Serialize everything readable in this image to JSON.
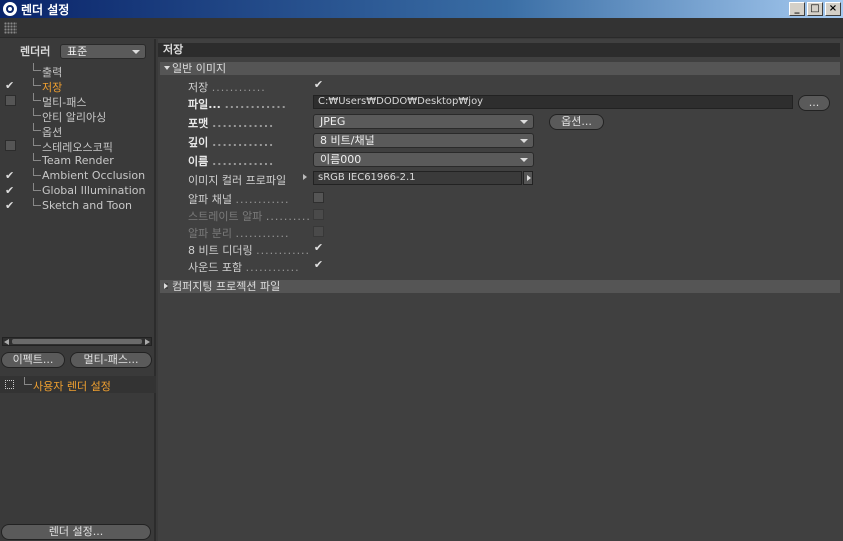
{
  "window": {
    "title": "렌더 설정",
    "minimize": "_",
    "maximize": "□",
    "close": "×"
  },
  "left": {
    "renderer_label": "렌더러",
    "renderer_value": "표준",
    "tree": [
      {
        "label": "출력",
        "check": "none"
      },
      {
        "label": "저장",
        "check": "checked",
        "selected": true
      },
      {
        "label": "멀티-패스",
        "check": "empty"
      },
      {
        "label": "안티 알리아싱",
        "check": "none"
      },
      {
        "label": "옵션",
        "check": "none"
      },
      {
        "label": "스테레오스코픽",
        "check": "empty"
      },
      {
        "label": "Team Render",
        "check": "none"
      },
      {
        "label": "Ambient Occlusion",
        "check": "checked"
      },
      {
        "label": "Global Illumination",
        "check": "checked"
      },
      {
        "label": "Sketch and Toon",
        "check": "checked"
      }
    ],
    "effects_button": "이펙트...",
    "multipass_button": "멀티-패스...",
    "user_render_setting": "사용자 렌더 설정",
    "render_settings_button": "렌더 설정..."
  },
  "right": {
    "section_title": "저장",
    "general_image": "일반 이미지",
    "save_label": "저장",
    "file_label": "파일...",
    "file_value": "C:₩Users₩DODO₩Desktop₩joy",
    "file_browse": "...",
    "format_label": "포맷",
    "format_value": "JPEG",
    "options_button": "옵션...",
    "depth_label": "깊이",
    "depth_value": "8 비트/채널",
    "name_label": "이름",
    "name_value": "이름000",
    "color_profile_label": "이미지 컬러 프로파일",
    "color_profile_value": "sRGB IEC61966-2.1",
    "alpha_label": "알파 채널",
    "straight_alpha_label": "스트레이트 알파",
    "separate_alpha_label": "알파 분리",
    "dither_label": "8 비트 디더링",
    "sound_label": "사운드 포함",
    "compositing_label": "컴퍼지팅 프로젝션 파일",
    "dots": "............",
    "checkmark": "✔"
  }
}
